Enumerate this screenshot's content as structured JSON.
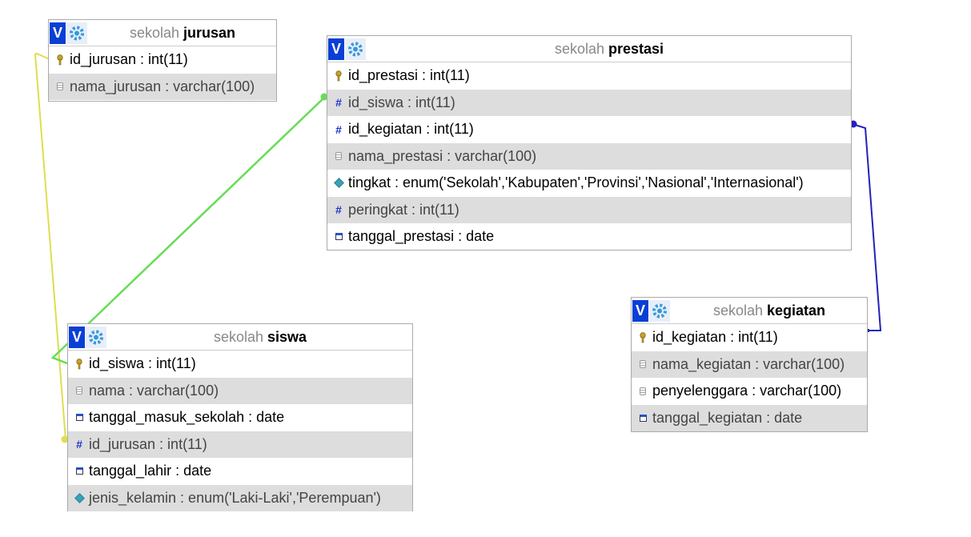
{
  "db_name": "sekolah",
  "colors": {
    "v_button": "#0a3fd6",
    "gear": "#3399dd",
    "alt_row": "#dddddd",
    "rel_jurusan_siswa": "#dede50",
    "rel_siswa_prestasi": "#66dd55",
    "rel_kegiatan_prestasi": "#2222bb"
  },
  "tables": {
    "jurusan": {
      "name": "jurusan",
      "columns": [
        {
          "label": "id_jurusan : int(11)",
          "icon": "key-icon"
        },
        {
          "label": "nama_jurusan : varchar(100)",
          "icon": "text-field-icon"
        }
      ]
    },
    "prestasi": {
      "name": "prestasi",
      "columns": [
        {
          "label": "id_prestasi : int(11)",
          "icon": "key-icon"
        },
        {
          "label": "id_siswa : int(11)",
          "icon": "number-hash-icon"
        },
        {
          "label": "id_kegiatan : int(11)",
          "icon": "number-hash-icon"
        },
        {
          "label": "nama_prestasi : varchar(100)",
          "icon": "text-field-icon"
        },
        {
          "label": "tingkat : enum('Sekolah','Kabupaten','Provinsi','Nasional','Internasional')",
          "icon": "enum-icon"
        },
        {
          "label": "peringkat : int(11)",
          "icon": "number-hash-icon"
        },
        {
          "label": "tanggal_prestasi : date",
          "icon": "calendar-icon"
        }
      ]
    },
    "kegiatan": {
      "name": "kegiatan",
      "columns": [
        {
          "label": "id_kegiatan : int(11)",
          "icon": "key-icon"
        },
        {
          "label": "nama_kegiatan : varchar(100)",
          "icon": "text-field-icon"
        },
        {
          "label": "penyelenggara : varchar(100)",
          "icon": "text-field-icon"
        },
        {
          "label": "tanggal_kegiatan : date",
          "icon": "calendar-icon"
        }
      ]
    },
    "siswa": {
      "name": "siswa",
      "columns": [
        {
          "label": "id_siswa : int(11)",
          "icon": "key-icon"
        },
        {
          "label": "nama : varchar(100)",
          "icon": "text-field-icon"
        },
        {
          "label": "tanggal_masuk_sekolah : date",
          "icon": "calendar-icon"
        },
        {
          "label": "id_jurusan : int(11)",
          "icon": "number-hash-icon"
        },
        {
          "label": "tanggal_lahir : date",
          "icon": "calendar-icon"
        },
        {
          "label": "jenis_kelamin : enum('Laki-Laki','Perempuan')",
          "icon": "enum-icon"
        }
      ]
    }
  },
  "header_buttons": {
    "v_label": "V",
    "gear_icon": "gear-icon"
  },
  "relations": [
    {
      "from": "siswa.id_jurusan",
      "to": "jurusan.id_jurusan"
    },
    {
      "from": "prestasi.id_siswa",
      "to": "siswa.id_siswa"
    },
    {
      "from": "prestasi.id_kegiatan",
      "to": "kegiatan.id_kegiatan"
    }
  ]
}
